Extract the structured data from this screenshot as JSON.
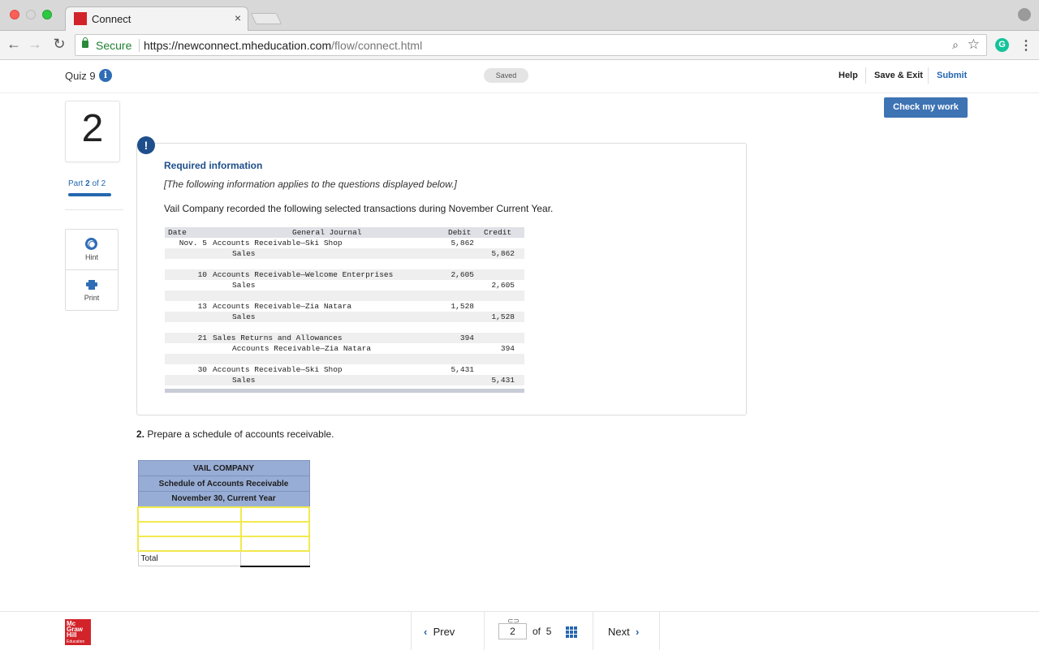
{
  "browser": {
    "tab_title": "Connect",
    "tab_close": "×",
    "secure_label": "Secure",
    "url_base": "https://newconnect.mheducation.com",
    "url_path": "/flow/connect.html",
    "favicon_text": "Mc Graw Hill"
  },
  "header": {
    "quiz_title": "Quiz 9",
    "info_glyph": "i",
    "saved_status": "Saved",
    "help_label": "Help",
    "save_exit_label": "Save & Exit",
    "submit_label": "Submit"
  },
  "rail": {
    "question_number": "2",
    "part_prefix": "Part",
    "part_current": "2",
    "part_suffix": "of 2",
    "hint_label": "Hint",
    "print_label": "Print"
  },
  "check_work_label": "Check my work",
  "required_info": {
    "alert_glyph": "!",
    "title": "Required information",
    "note": "[The following information applies to the questions displayed below.]",
    "intro": "Vail Company recorded the following selected transactions during November Current Year."
  },
  "journal": {
    "headers": {
      "date": "Date",
      "general_journal": "General Journal",
      "debit": "Debit",
      "credit": "Credit"
    },
    "rows": [
      {
        "date": "Nov. 5",
        "debit_account": "Accounts Receivable—Ski Shop",
        "credit_account": "Sales",
        "debit": "5,862",
        "credit": "5,862"
      },
      {
        "date": "10",
        "debit_account": "Accounts Receivable—Welcome Enterprises",
        "credit_account": "Sales",
        "debit": "2,605",
        "credit": "2,605"
      },
      {
        "date": "13",
        "debit_account": "Accounts Receivable—Zia Natara",
        "credit_account": "Sales",
        "debit": "1,528",
        "credit": "1,528"
      },
      {
        "date": "21",
        "debit_account": "Sales Returns and Allowances",
        "credit_account": "Accounts Receivable—Zia Natara",
        "debit": "394",
        "credit": "394"
      },
      {
        "date": "30",
        "debit_account": "Accounts Receivable—Ski Shop",
        "credit_account": "Sales",
        "debit": "5,431",
        "credit": "5,431"
      }
    ]
  },
  "question": {
    "number": "2.",
    "text": "Prepare a schedule of accounts receivable."
  },
  "schedule": {
    "company": "VAIL COMPANY",
    "title": "Schedule of Accounts Receivable",
    "date": "November 30, Current Year",
    "total_label": "Total",
    "rows": [
      {
        "name": "",
        "amount": ""
      },
      {
        "name": "",
        "amount": ""
      },
      {
        "name": "",
        "amount": ""
      }
    ]
  },
  "footer": {
    "logo_text": "Mc Graw Hill",
    "logo_sub": "Education",
    "prev_label": "Prev",
    "next_label": "Next",
    "current_page": "2",
    "of_text": "of",
    "total_pages": "5",
    "prev_chevron": "‹",
    "next_chevron": "›"
  },
  "colors": {
    "accent": "#2567b0",
    "button": "#3e73b4",
    "schedule_header": "#98add5",
    "input_border": "#f2e94e",
    "brand_red": "#d2232a"
  }
}
